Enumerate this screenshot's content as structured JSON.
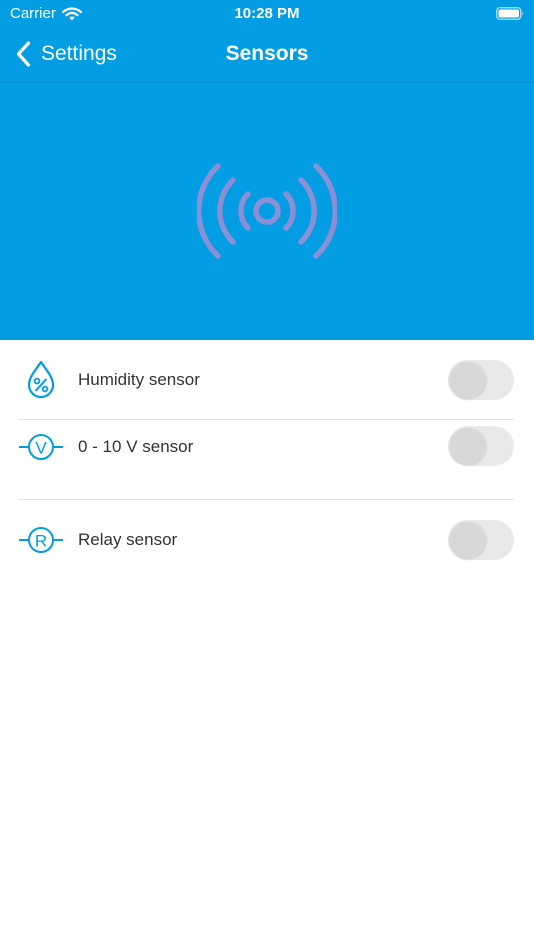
{
  "status_bar": {
    "carrier": "Carrier",
    "time": "10:28 PM"
  },
  "nav": {
    "back_label": "Settings",
    "title": "Sensors"
  },
  "colors": {
    "header_bg": "#029de3",
    "hero_icon": "#8b8fd6",
    "list_icon": "#029de3",
    "toggle_off": "#e9e9ea"
  },
  "hero_icon": "broadcast-signal-icon",
  "sensors": [
    {
      "label": "Humidity sensor",
      "icon": "humidity-drop-icon",
      "enabled": false
    },
    {
      "label": "0 - 10 V sensor",
      "icon": "voltage-v-icon",
      "enabled": false
    },
    {
      "label": "Relay sensor",
      "icon": "relay-r-icon",
      "enabled": false
    }
  ]
}
